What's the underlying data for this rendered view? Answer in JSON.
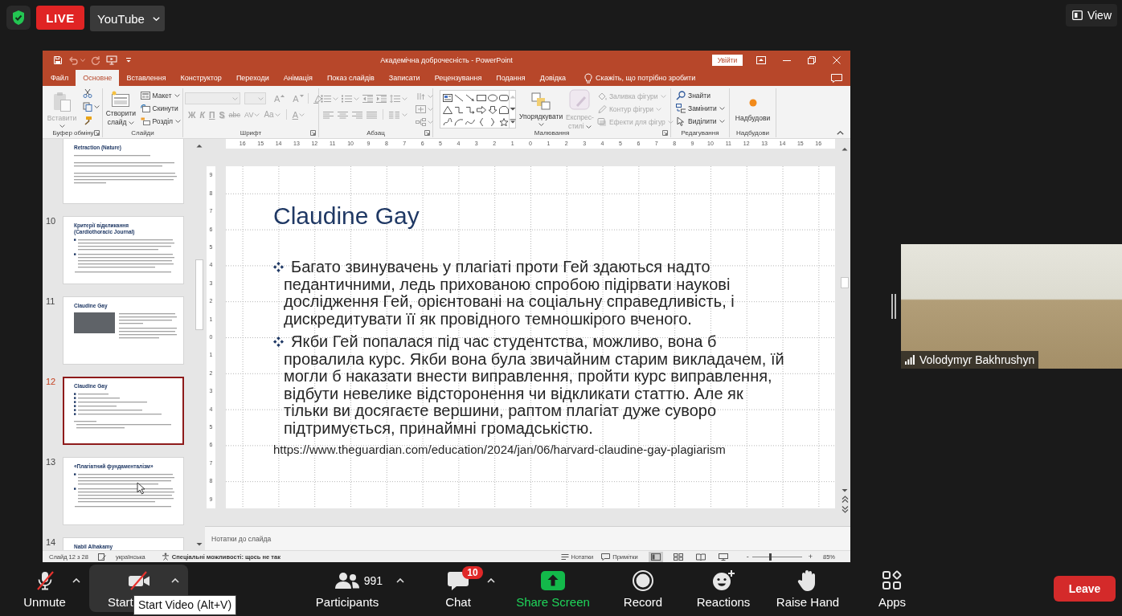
{
  "top_bar": {
    "live_badge": "LIVE",
    "stream_target": "YouTube",
    "view_button": "View"
  },
  "powerpoint": {
    "title": "Академічна доброчесність - PowerPoint",
    "sign_in": "Увійти",
    "tabs": [
      {
        "label": "Файл",
        "selected": false
      },
      {
        "label": "Основне",
        "selected": true
      },
      {
        "label": "Вставлення",
        "selected": false
      },
      {
        "label": "Конструктор",
        "selected": false
      },
      {
        "label": "Переходи",
        "selected": false
      },
      {
        "label": "Анімація",
        "selected": false
      },
      {
        "label": "Показ слайдів",
        "selected": false
      },
      {
        "label": "Записати",
        "selected": false
      },
      {
        "label": "Рецензування",
        "selected": false
      },
      {
        "label": "Подання",
        "selected": false
      },
      {
        "label": "Довідка",
        "selected": false
      }
    ],
    "tell_me": {
      "placeholder": "Скажіть, що потрібно зробити"
    },
    "ribbon": [
      {
        "kind": "clipboard",
        "label": "Буфер обміну",
        "launcher": true,
        "paste": {
          "label": "Вставити",
          "disabled": true
        }
      },
      {
        "kind": "slides",
        "label": "Слайди",
        "launcher": false,
        "new_slide": "Створити слайд",
        "commands": [
          {
            "kind": "layout",
            "label": "Макет",
            "menu": true
          },
          {
            "kind": "reset",
            "label": "Скинути",
            "menu": false
          },
          {
            "kind": "section",
            "label": "Розділ",
            "menu": true
          }
        ]
      },
      {
        "kind": "font",
        "label": "Шрифт",
        "launcher": true,
        "disabled": true,
        "size_buttons": [
          "A",
          "A"
        ],
        "format_buttons": [
          {
            "kind": "bold",
            "label": "Ж",
            "menu": false
          },
          {
            "kind": "italic",
            "label": "К",
            "menu": false
          },
          {
            "kind": "underline",
            "label": "П",
            "menu": false
          },
          {
            "kind": "shadow",
            "label": "S",
            "menu": false
          },
          {
            "kind": "strike",
            "label": "abc",
            "menu": false
          },
          {
            "kind": "spacing",
            "label": "AV",
            "menu": true
          },
          {
            "kind": "case",
            "label": "Aa",
            "menu": true
          },
          {
            "kind": "color",
            "label": "A",
            "menu": true
          }
        ]
      },
      {
        "kind": "paragraph",
        "label": "Абзац",
        "launcher": true,
        "disabled": true
      },
      {
        "kind": "drawing",
        "label": "Малювання",
        "launcher": true,
        "arrange": "Упорядкувати",
        "quick_styles": {
          "label": "Експрес-стилі",
          "disabled": true
        },
        "commands": [
          {
            "kind": "fill",
            "label": "Заливка фігури",
            "disabled": true
          },
          {
            "kind": "outline",
            "label": "Контур фігури",
            "disabled": true
          },
          {
            "kind": "effects",
            "label": "Ефекти для фігур",
            "disabled": true
          }
        ]
      },
      {
        "kind": "editing",
        "label": "Редагування",
        "launcher": false,
        "commands": [
          {
            "kind": "find",
            "label": "Знайти",
            "menu": false
          },
          {
            "kind": "replace",
            "label": "Замінити",
            "menu": true
          },
          {
            "kind": "select",
            "label": "Виділити",
            "menu": true
          }
        ]
      },
      {
        "kind": "addins",
        "label": "Надбудови",
        "launcher": false,
        "button": "Надбудови"
      }
    ],
    "thumbnails": [
      {
        "kind": "text",
        "title": "Retraction (Nature)",
        "selected": false
      },
      {
        "kind": "bullets",
        "number": "10",
        "title": "Критерії відкликання (Cardiothoracic Journal)",
        "selected": false
      },
      {
        "kind": "photo",
        "number": "11",
        "title": "Claudine Gay",
        "selected": false
      },
      {
        "kind": "bullets",
        "number": "12",
        "title": "Claudine Gay",
        "selected": true
      },
      {
        "kind": "bullets",
        "number": "13",
        "title": "«Плагіатний фундаменталізм»",
        "selected": false
      },
      {
        "kind": "title",
        "number": "14",
        "title": "Nabil Alhakamy",
        "selected": false
      }
    ],
    "ruler": {
      "horizontal": [
        "16",
        "15",
        "14",
        "13",
        "12",
        "11",
        "10",
        "9",
        "8",
        "7",
        "6",
        "5",
        "4",
        "3",
        "2",
        "1",
        "0",
        "1",
        "2",
        "3",
        "4",
        "5",
        "6",
        "7",
        "8",
        "9",
        "10",
        "11",
        "12",
        "13",
        "14",
        "15",
        "16"
      ],
      "vertical": [
        "9",
        "8",
        "7",
        "6",
        "5",
        "4",
        "3",
        "2",
        "1",
        "0",
        "1",
        "2",
        "3",
        "4",
        "5",
        "6",
        "7",
        "8",
        "9"
      ]
    },
    "slide": {
      "title": "Claudine Gay",
      "bullets": [
        "Багато звинувачень у плагіаті проти Гей здаються надто педантичними, ледь прихованою спробою підірвати наукові дослідження Гей, орієнтовані на соціальну справедливість, і дискредитувати її як провідного темношкірого вченого.",
        "Якби Гей попалася під час студентства, можливо, вона б провалила курс. Якби вона була звичайним старим викладачем, їй могли б наказати внести виправлення, пройти курс виправлення, відбути невелике відсторонення чи відкликати статтю. Але як тільки ви досягаєте вершини, раптом плагіат дуже суворо підтримується, принаймні громадськістю."
      ],
      "link": "https://www.theguardian.com/education/2024/jan/06/harvard-claudine-gay-plagiarism"
    },
    "notes": {
      "placeholder": "Нотатки до слайда"
    },
    "status_bar": {
      "slide_position": "Слайд 12 з 28",
      "language": "українська",
      "accessibility": "Спеціальні можливості: щось не так",
      "notes_button": "Нотатки",
      "comments_button": "Примітки",
      "views": [
        {
          "kind": "normal",
          "selected": true
        },
        {
          "kind": "sorter",
          "selected": false
        },
        {
          "kind": "reading",
          "selected": false
        },
        {
          "kind": "slideshow",
          "selected": false
        }
      ],
      "zoom": {
        "minus": "-",
        "plus": "+",
        "level": 0.37,
        "reading": "85%"
      }
    }
  },
  "video_tile": {
    "name": "Volodymyr Bakhrushyn"
  },
  "toolbar": {
    "items": [
      {
        "kind": "mic",
        "label": "Unmute",
        "off": true,
        "menu": true,
        "highlighted": false
      },
      {
        "kind": "camera",
        "label": "Start",
        "off": true,
        "menu": true,
        "highlighted": true
      },
      {
        "kind": "participants",
        "label": "Participants",
        "count": "991",
        "menu": true,
        "highlighted": false
      },
      {
        "kind": "chat",
        "label": "Chat",
        "badge": "10",
        "menu": true,
        "highlighted": false
      },
      {
        "kind": "share",
        "label": "Share Screen",
        "menu": false,
        "highlighted": false
      },
      {
        "kind": "record",
        "label": "Record",
        "menu": false,
        "highlighted": false
      },
      {
        "kind": "reactions",
        "label": "Reactions",
        "menu": false,
        "highlighted": false
      },
      {
        "kind": "raise_hand",
        "label": "Raise Hand",
        "menu": false,
        "highlighted": false
      },
      {
        "kind": "apps",
        "label": "Apps",
        "menu": false,
        "highlighted": false
      }
    ],
    "leave": "Leave",
    "tooltip": "Start Video (Alt+V)"
  }
}
